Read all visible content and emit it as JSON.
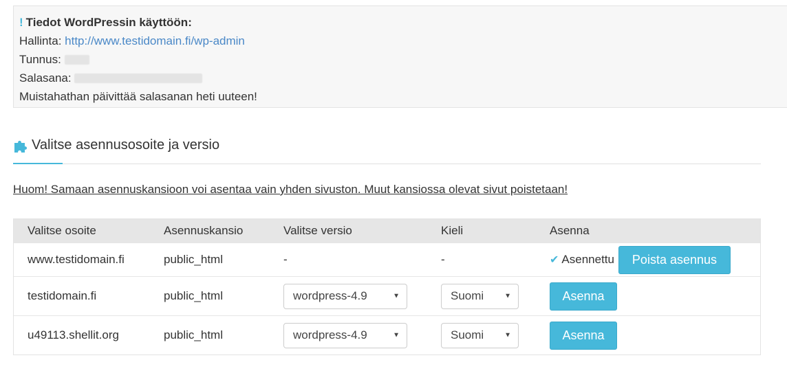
{
  "info": {
    "exclamation": "!",
    "title": "Tiedot WordPressin käyttöön:",
    "admin_label": "Hallinta:",
    "admin_url": "http://www.testidomain.fi/wp-admin",
    "user_label": "Tunnus:",
    "password_label": "Salasana:",
    "reminder": "Muistahathan päivittää salasanan heti uuteen!"
  },
  "section": {
    "icon": "puzzle-icon",
    "title": "Valitse asennusosoite ja versio"
  },
  "warning": "Huom! Samaan asennuskansioon voi asentaa vain yhden sivuston. Muut kansiossa olevat sivut poistetaan!",
  "table": {
    "headers": [
      "Valitse osoite",
      "Asennuskansio",
      "Valitse versio",
      "Kieli",
      "Asenna"
    ],
    "rows": [
      {
        "address": "www.testidomain.fi",
        "folder": "public_html",
        "version": "-",
        "language": "-",
        "status": "Asennettu",
        "action": "Poista asennus"
      },
      {
        "address": "testidomain.fi",
        "folder": "public_html",
        "version": "wordpress-4.9",
        "language": "Suomi",
        "action": "Asenna"
      },
      {
        "address": "u49113.shellit.org",
        "folder": "public_html",
        "version": "wordpress-4.9",
        "language": "Suomi",
        "action": "Asenna"
      }
    ]
  },
  "colors": {
    "accent": "#46b8da",
    "link": "#4a88c7",
    "header_bg": "#e6e6e6",
    "info_bg": "#f7f7f7"
  }
}
